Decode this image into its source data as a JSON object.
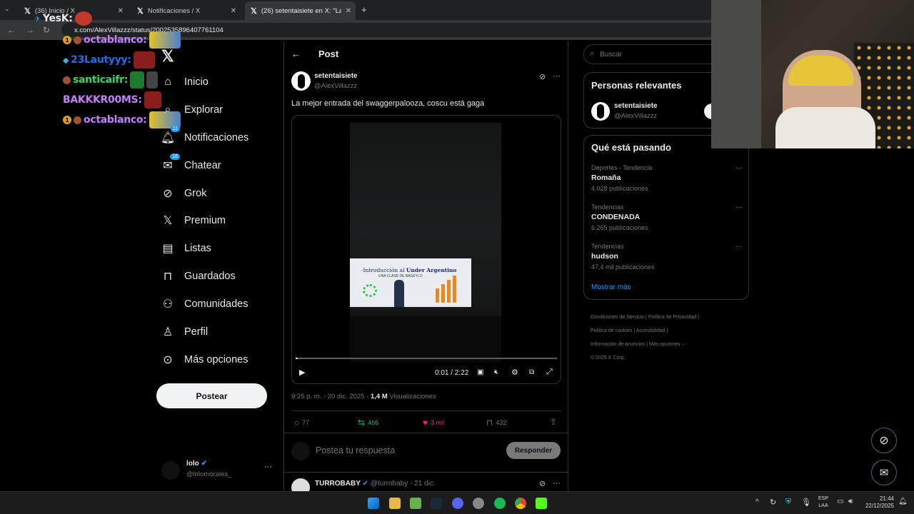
{
  "browser": {
    "tabs": [
      {
        "title": "(36) Inicio / X"
      },
      {
        "title": "Notificaciones / X"
      },
      {
        "title": "(26) setentaisiete en X: \"La mejo"
      }
    ],
    "url": "x.com/AlexVillazzz/status/2002535896407761104"
  },
  "chat_overlay": [
    {
      "name": "YesK:",
      "color": "#e9e9e9"
    },
    {
      "name": "octablanco:",
      "color": "#c77dff"
    },
    {
      "name": "23Lautyyy:",
      "color": "#1e6ff0"
    },
    {
      "name": "santicaifr:",
      "color": "#38d66b"
    },
    {
      "name": "BAKKKR00MS:",
      "color": "#c77dff"
    },
    {
      "name": "octablanco:",
      "color": "#c77dff"
    }
  ],
  "nav": {
    "items": [
      {
        "label": "Inicio",
        "icon": "home-icon"
      },
      {
        "label": "Explorar",
        "icon": "search-icon"
      },
      {
        "label": "Notificaciones",
        "icon": "bell-icon",
        "badge": "11"
      },
      {
        "label": "Chatear",
        "icon": "mail-icon",
        "badge": "16"
      },
      {
        "label": "Grok",
        "icon": "grok-icon"
      },
      {
        "label": "Premium",
        "icon": "x-logo-icon"
      },
      {
        "label": "Listas",
        "icon": "list-icon"
      },
      {
        "label": "Guardados",
        "icon": "bookmark-icon"
      },
      {
        "label": "Comunidades",
        "icon": "people-icon"
      },
      {
        "label": "Perfil",
        "icon": "user-icon"
      },
      {
        "label": "Más opciones",
        "icon": "more-circle-icon"
      }
    ],
    "post_button": "Postear",
    "account": {
      "name": "lolo",
      "handle": "@lolomorales_"
    }
  },
  "post": {
    "header_title": "Post",
    "author_name": "setentaisiete",
    "author_handle": "@AlexVillazzz",
    "text": "La mejor entrada del swaggerpalooza, coscu está gaga",
    "video": {
      "slide_title_1": "-Introducción al ",
      "slide_title_2": "Under Argentino",
      "slide_subtitle": "UNA CLASE DE BAGEYLO",
      "time": "0:01 / 2:22",
      "progress": 0.007
    },
    "meta_time": "9:25 p. m. · 20 dic. 2025 · ",
    "views_count": "1,4 M",
    "views_label": "Visualizaciones",
    "replies": "77",
    "reposts": "466",
    "likes": "3 mil",
    "bookmarks": "432",
    "reply_placeholder": "Postea tu respuesta",
    "reply_button": "Responder",
    "next_reply": {
      "name": "TURROBABY",
      "handle": "@turrobaby · 21 dic."
    }
  },
  "sidebar": {
    "search_placeholder": "Buscar",
    "relevant_title": "Personas relevantes",
    "relevant_person": {
      "name": "setentaisiete",
      "handle": "@AlexVillazzz"
    },
    "trending_title": "Qué está pasando",
    "trends": [
      {
        "category": "Deportes · Tendencia",
        "name": "Romaña",
        "count": "4.028 publicaciones"
      },
      {
        "category": "Tendencias",
        "name": "CONDENADA",
        "count": "6.265 publicaciones"
      },
      {
        "category": "Tendencias",
        "name": "hudson",
        "count": "47,4 mil publicaciones"
      }
    ],
    "show_more": "Mostrar más",
    "footer": {
      "l1": "Condiciones de Servicio",
      "l2": "Política de Privacidad",
      "l3": "Política de cookies",
      "l4": "Accesibilidad",
      "l5": "Información de anuncios",
      "l6": "Más opciones ···",
      "l7": "© 2025 X Corp."
    }
  },
  "taskbar": {
    "lang1": "ESP",
    "lang2": "LAA",
    "time": "21:44",
    "date": "22/12/2025"
  },
  "colors": {
    "accent": "#1d9bf0",
    "like": "#f91880",
    "repost": "#00ba7c"
  }
}
